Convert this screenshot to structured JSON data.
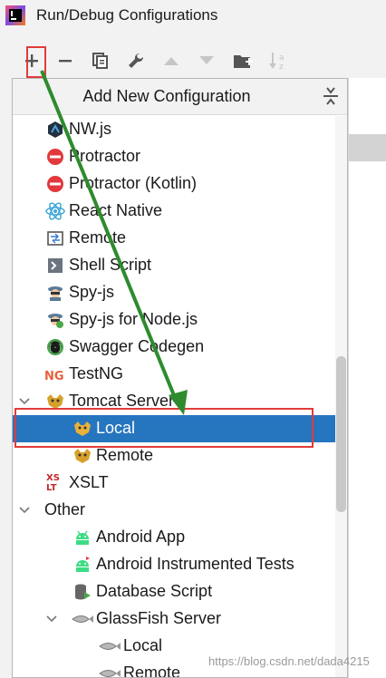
{
  "window": {
    "title": "Run/Debug Configurations"
  },
  "toolbar": {
    "buttons": [
      {
        "name": "add-icon",
        "enabled": true
      },
      {
        "name": "remove-icon",
        "enabled": true
      },
      {
        "name": "copy-icon",
        "enabled": true
      },
      {
        "name": "wrench-icon",
        "enabled": true
      },
      {
        "name": "move-up-icon",
        "enabled": false
      },
      {
        "name": "move-down-icon",
        "enabled": false
      },
      {
        "name": "new-folder-icon",
        "enabled": true
      },
      {
        "name": "sort-alpha-icon",
        "enabled": false
      }
    ]
  },
  "popup": {
    "title": "Add New Configuration",
    "items": [
      {
        "label": "NW.js",
        "icon": "nwjs-icon",
        "level": 1
      },
      {
        "label": "Protractor",
        "icon": "protractor-icon",
        "level": 1
      },
      {
        "label": "Protractor (Kotlin)",
        "icon": "protractor-icon",
        "level": 1
      },
      {
        "label": "React Native",
        "icon": "react-icon",
        "level": 1
      },
      {
        "label": "Remote",
        "icon": "remote-icon",
        "level": 1
      },
      {
        "label": "Shell Script",
        "icon": "shell-icon",
        "level": 1
      },
      {
        "label": "Spy-js",
        "icon": "spyjs-icon",
        "level": 1
      },
      {
        "label": "Spy-js for Node.js",
        "icon": "spyjs-node-icon",
        "level": 1
      },
      {
        "label": "Swagger Codegen",
        "icon": "swagger-icon",
        "level": 1
      },
      {
        "label": "TestNG",
        "icon": "testng-icon",
        "level": 1
      },
      {
        "label": "Tomcat Server",
        "icon": "tomcat-icon",
        "level": 1,
        "expanded": true
      },
      {
        "label": "Local",
        "icon": "tomcat-icon",
        "level": 2,
        "selected": true
      },
      {
        "label": "Remote",
        "icon": "tomcat-icon",
        "level": 2
      },
      {
        "label": "XSLT",
        "icon": "xslt-icon",
        "level": 1
      },
      {
        "label": "Other",
        "icon": "",
        "level": 0,
        "expanded": true
      },
      {
        "label": "Android App",
        "icon": "android-icon",
        "level": 2
      },
      {
        "label": "Android Instrumented Tests",
        "icon": "android-test-icon",
        "level": 2
      },
      {
        "label": "Database Script",
        "icon": "database-icon",
        "level": 2
      },
      {
        "label": "GlassFish Server",
        "icon": "glassfish-icon",
        "level": 2,
        "expanded": true
      },
      {
        "label": "Local",
        "icon": "glassfish-icon",
        "level": 3
      },
      {
        "label": "Remote",
        "icon": "glassfish-icon",
        "level": 3
      }
    ]
  },
  "watermark": "https://blog.csdn.net/dada4215",
  "colors": {
    "selection": "#2675bf",
    "annotation_red": "#e23b3b",
    "annotation_arrow": "#2e8b2e"
  }
}
